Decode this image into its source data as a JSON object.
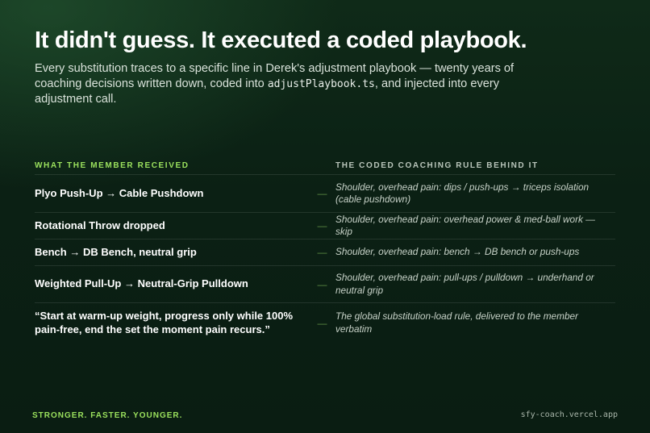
{
  "headline": "It didn't guess. It executed a coded playbook.",
  "subtitle": {
    "before": "Every substitution traces to a specific line in Derek's adjustment playbook — twenty years of coaching decisions written down, coded into ",
    "code": "adjustPlaybook.ts",
    "after": ", and injected into every adjustment call."
  },
  "columns": {
    "left": "WHAT THE MEMBER RECEIVED",
    "right": "THE CODED COACHING RULE BEHIND IT"
  },
  "separator": "—",
  "rows": [
    {
      "received": "Plyo Push-Up → Cable Pushdown",
      "rule": "Shoulder, overhead pain: dips / push-ups → triceps isolation (cable pushdown)"
    },
    {
      "received": "Rotational Throw dropped",
      "rule": "Shoulder, overhead pain: overhead power & med-ball work — skip"
    },
    {
      "received": "Bench → DB Bench, neutral grip",
      "rule": "Shoulder, overhead pain: bench → DB bench or push-ups"
    },
    {
      "received": "Weighted Pull-Up → Neutral-Grip Pulldown",
      "rule": "Shoulder, overhead pain: pull-ups / pulldown → underhand or neutral grip"
    },
    {
      "received": "“Start at warm-up weight, progress only while 100% pain-free, end the set the moment pain recurs.”",
      "rule": "The global substitution-load rule, delivered to the member verbatim"
    }
  ],
  "footer": {
    "tagline": "STRONGER. FASTER. YOUNGER.",
    "url": "sfy-coach.vercel.app"
  }
}
